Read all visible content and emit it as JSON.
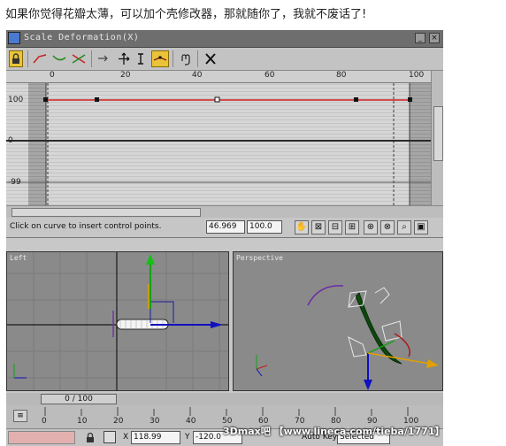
{
  "caption": "如果你觉得花瓣太薄，可以加个壳修改器，那就随你了，我就不废话了!",
  "window": {
    "title": "Scale Deformation(X)",
    "title_buttons": [
      "_",
      "×"
    ]
  },
  "toolbar": {
    "icons": [
      "lock-icon",
      "curve-red-icon",
      "curve-green-icon",
      "curve-both-icon",
      "swap-icon",
      "move-icon",
      "scale-icon",
      "insert-point-icon",
      "reset-icon",
      "delete-icon"
    ]
  },
  "graph": {
    "ruler_labels": [
      "0",
      "20",
      "40",
      "60",
      "80",
      "100"
    ],
    "y_labels": [
      "100",
      "0",
      "-99"
    ],
    "curve_color": "#d02020"
  },
  "status": {
    "message": "Click on curve to insert control points.",
    "field1": "46.969",
    "field2": "100.0"
  },
  "viewports": {
    "left_label": "Left",
    "persp_label": "Perspective"
  },
  "timeline": {
    "slider_text": "0 / 100",
    "ticks": [
      "0",
      "10",
      "20",
      "30",
      "40",
      "50",
      "60",
      "70",
      "80",
      "90",
      "100"
    ]
  },
  "bottom": {
    "x_label": "X",
    "x_value": "118.99",
    "y_label": "Y",
    "y_value": "-120.0",
    "autokey": "Auto Key",
    "selected": "Selected"
  },
  "watermark": "3Dmax吧 【www.lineca.com/tieba/1771】"
}
